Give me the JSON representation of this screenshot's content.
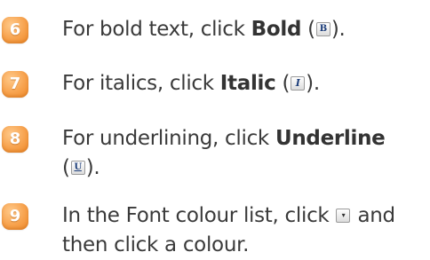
{
  "steps": [
    {
      "number": "6",
      "before": "For bold text, click ",
      "command": "Bold",
      "open": " (",
      "icon": "B",
      "icon_name": "bold-icon",
      "close": ")."
    },
    {
      "number": "7",
      "before": "For italics, click ",
      "command": "Italic",
      "open": " (",
      "icon": "I",
      "icon_name": "italic-icon",
      "close": ")."
    },
    {
      "number": "8",
      "before": "For underlining, click ",
      "command": "Underline",
      "open": "(",
      "icon": "U",
      "icon_name": "underline-icon",
      "close": ")."
    },
    {
      "number": "9",
      "line1_before": "In the Font colour list, click ",
      "icon": "▾",
      "icon_name": "dropdown-arrow-icon",
      "line1_after": " and",
      "line2": "then click a colour."
    }
  ],
  "colors": {
    "badge": "#f7a24d",
    "text": "#3a3a3a",
    "icon_glyph": "#1c3d7a"
  }
}
